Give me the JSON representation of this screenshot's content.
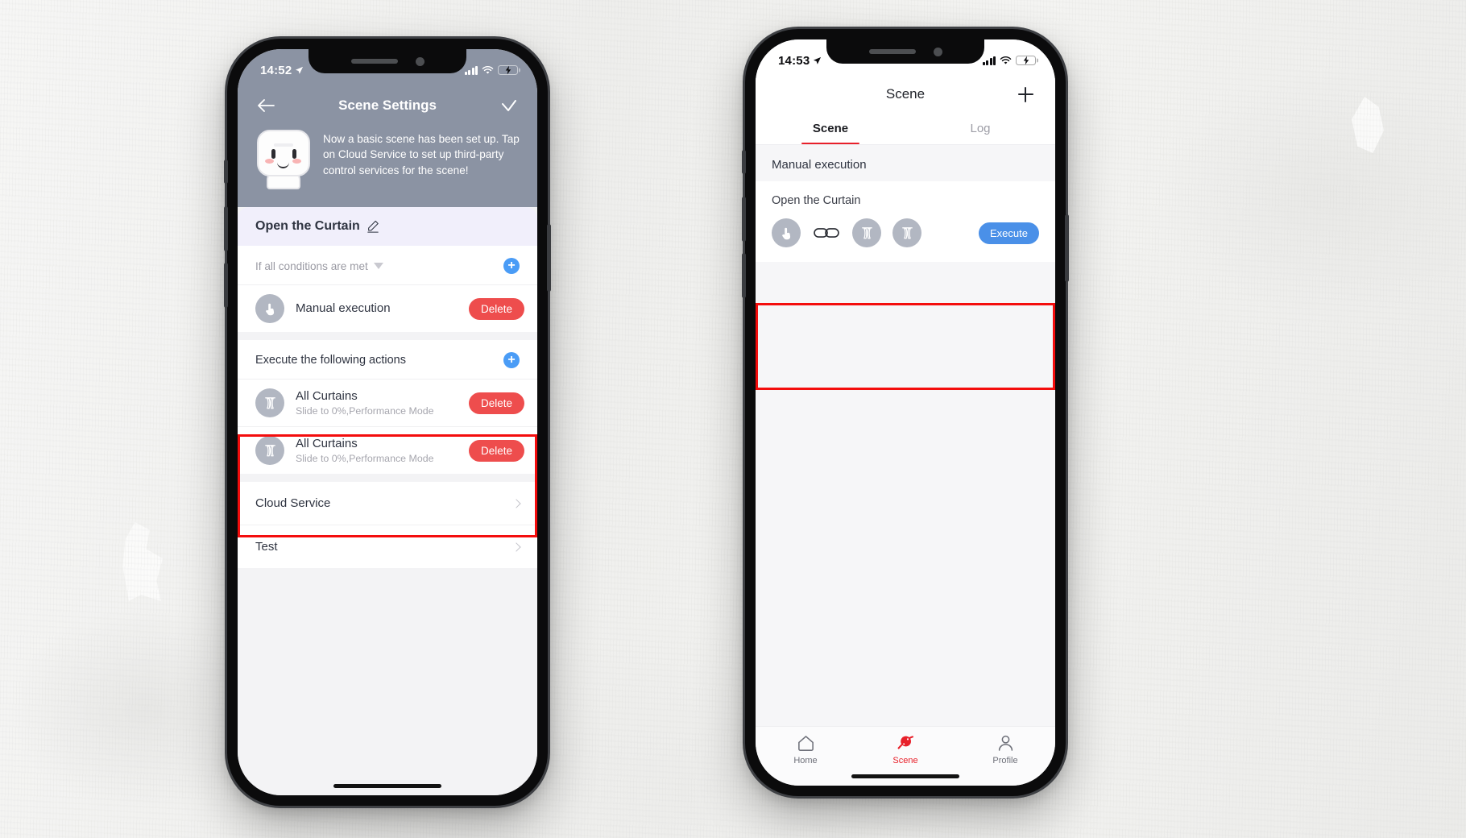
{
  "app": {
    "accent_red": "#e8202a",
    "accent_blue": "#4a90e8",
    "delete_red": "#ee4d4d",
    "highlight_red": "#f40d0d",
    "header_gray": "#8b93a3",
    "icon_gray": "#b2b7c2"
  },
  "left_phone": {
    "status_bar": {
      "time": "14:52",
      "location_icon": "location-arrow-icon",
      "signal_icon": "cellular-signal-icon",
      "wifi_icon": "wifi-icon",
      "battery_icon": "battery-charging-icon"
    },
    "navbar": {
      "back_icon": "back-arrow-icon",
      "title": "Scene Settings",
      "confirm_icon": "checkmark-icon"
    },
    "intro": {
      "mascot_icon": "robot-mascot-icon",
      "text": "Now a basic scene has been set up. Tap on Cloud Service to set up third-party control services for the scene!"
    },
    "scene_name": {
      "name": "Open the Curtain",
      "edit_icon": "pencil-edit-icon"
    },
    "conditions": {
      "label": "If all conditions are met",
      "dropdown_icon": "caret-down-icon",
      "add_icon": "plus-circle-icon",
      "items": [
        {
          "icon": "hand-tap-icon",
          "title": "Manual execution",
          "subtitle": "",
          "delete_label": "Delete"
        }
      ]
    },
    "actions": {
      "label": "Execute the following actions",
      "add_icon": "plus-circle-icon",
      "items": [
        {
          "icon": "curtain-icon",
          "title": "All Curtains",
          "subtitle": "Slide to 0%,Performance Mode",
          "delete_label": "Delete"
        },
        {
          "icon": "curtain-icon",
          "title": "All Curtains",
          "subtitle": "Slide to 0%,Performance Mode",
          "delete_label": "Delete"
        }
      ]
    },
    "links": [
      {
        "label": "Cloud Service",
        "chevron_icon": "chevron-right-icon"
      },
      {
        "label": "Test",
        "chevron_icon": "chevron-right-icon"
      }
    ]
  },
  "right_phone": {
    "status_bar": {
      "time": "14:53",
      "location_icon": "location-arrow-icon",
      "signal_icon": "cellular-signal-icon",
      "wifi_icon": "wifi-icon",
      "battery_icon": "battery-charging-icon"
    },
    "navbar": {
      "title": "Scene",
      "add_icon": "plus-icon"
    },
    "tabs": [
      {
        "label": "Scene",
        "active": true
      },
      {
        "label": "Log",
        "active": false
      }
    ],
    "section_label": "Manual execution",
    "scene_card": {
      "title": "Open the Curtain",
      "icons": [
        "hand-tap-icon",
        "link-chain-icon",
        "curtain-icon",
        "curtain-icon"
      ],
      "execute_label": "Execute"
    },
    "tabbar": [
      {
        "icon": "home-icon",
        "label": "Home",
        "active": false
      },
      {
        "icon": "planet-scene-icon",
        "label": "Scene",
        "active": true
      },
      {
        "icon": "person-profile-icon",
        "label": "Profile",
        "active": false
      }
    ]
  }
}
